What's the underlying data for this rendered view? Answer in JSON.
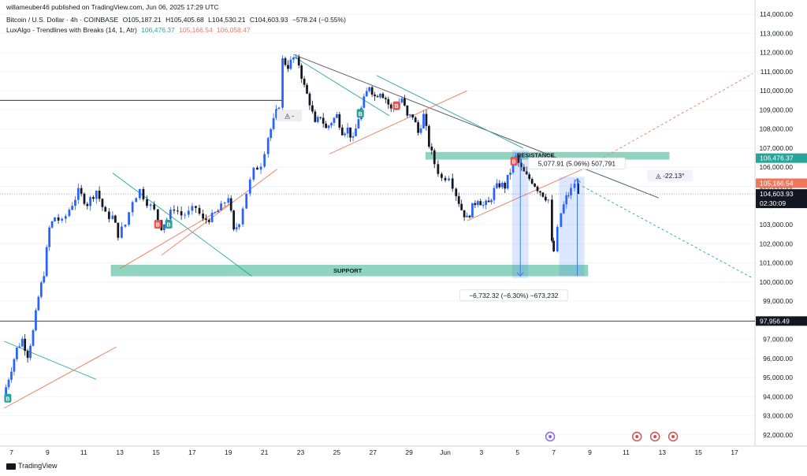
{
  "header": {
    "publisher": "willameuber46 published on TradingView.com, Jun 06, 2025 17:29 UTC",
    "symbol": "Bitcoin / U.S. Dollar · 4h · COINBASE",
    "ohlc": {
      "o": "O105,187.21",
      "h": "H105,405.68",
      "l": "L104,530.21",
      "c": "C104,603.93",
      "chg": "−578.24 (−0.55%)"
    },
    "indicator": {
      "name": "LuxAlgo - Trendlines with Breaks (14, 1, Atr)",
      "v1": "106,476.37",
      "v2": "105,166.54",
      "v3": "106,058.47"
    }
  },
  "footer": {
    "brand": "TradingView"
  },
  "colors": {
    "up": "#2962ff",
    "down": "#131722",
    "teal": "#26a69a",
    "zone": "#8fd4bf",
    "red_trend": "#f0785a",
    "measure": "#3f7af5"
  },
  "price_labels": {
    "upper": "106,476.37",
    "lower": "105,166.54",
    "last": "104,603.93",
    "countdown": "02:30:09",
    "hline": "97,956.49"
  },
  "annotations": {
    "resistance": "RESISTANCE",
    "support": "SUPPORT",
    "measure_up": "5,077.91 (5.06%) 507,791",
    "measure_down": "−6,732.32 (−6.30%) −673,232",
    "angle_right": "-22.13°",
    "angle_left": "-",
    "break_b": "B"
  },
  "chart_data": {
    "type": "candlestick",
    "title": "Bitcoin / U.S. Dollar · 4h · COINBASE",
    "ylim": [
      91500,
      114500
    ],
    "y_ticks": [
      "92,000.00",
      "93,000.00",
      "94,000.00",
      "95,000.00",
      "96,000.00",
      "97,000.00",
      "98,000.00",
      "99,000.00",
      "100,000.00",
      "101,000.00",
      "102,000.00",
      "103,000.00",
      "104,000.00",
      "105,000.00",
      "106,000.00",
      "107,000.00",
      "108,000.00",
      "109,000.00",
      "110,000.00",
      "111,000.00",
      "112,000.00",
      "113,000.00",
      "114,000.00"
    ],
    "x_ticks": [
      "7",
      "9",
      "11",
      "13",
      "15",
      "17",
      "19",
      "21",
      "23",
      "25",
      "27",
      "29",
      "Jun",
      "3",
      "5",
      "7",
      "9",
      "11",
      "13",
      "15",
      "17"
    ],
    "x_tick_days": [
      7,
      9,
      11,
      13,
      15,
      17,
      19,
      21,
      23,
      25,
      27,
      29,
      31,
      33,
      35,
      37,
      39,
      41,
      43,
      45,
      47
    ],
    "x_range_days": [
      6.5,
      48
    ],
    "last_candle_day": 37,
    "key_levels": {
      "resistance": [
        106400,
        106800
      ],
      "support": [
        100300,
        100900
      ],
      "hline_upper": 109500,
      "hline_lower": 97956.49,
      "last_price": 104603.93
    },
    "path": [
      [
        6.55,
        94000
      ],
      [
        7.0,
        95500
      ],
      [
        7.3,
        96500
      ],
      [
        7.6,
        97000
      ],
      [
        7.9,
        96200
      ],
      [
        8.2,
        97400
      ],
      [
        8.5,
        99200
      ],
      [
        8.8,
        100500
      ],
      [
        9.1,
        102800
      ],
      [
        9.4,
        103400
      ],
      [
        9.8,
        103100
      ],
      [
        10.2,
        103800
      ],
      [
        10.7,
        104700
      ],
      [
        11.2,
        104100
      ],
      [
        11.7,
        104800
      ],
      [
        12.2,
        103500
      ],
      [
        12.6,
        103400
      ],
      [
        12.9,
        102500
      ],
      [
        13.3,
        103000
      ],
      [
        13.7,
        104300
      ],
      [
        14.1,
        104800
      ],
      [
        14.5,
        104200
      ],
      [
        14.9,
        103700
      ],
      [
        15.3,
        102900
      ],
      [
        15.6,
        103300
      ],
      [
        16.0,
        103900
      ],
      [
        16.4,
        103500
      ],
      [
        16.8,
        103600
      ],
      [
        17.2,
        103900
      ],
      [
        17.6,
        103200
      ],
      [
        18.1,
        103400
      ],
      [
        18.6,
        103900
      ],
      [
        19.0,
        104500
      ],
      [
        19.3,
        102600
      ],
      [
        19.6,
        103200
      ],
      [
        20.0,
        104700
      ],
      [
        20.4,
        105800
      ],
      [
        20.8,
        106200
      ],
      [
        21.2,
        107600
      ],
      [
        21.5,
        108400
      ],
      [
        21.8,
        109300
      ],
      [
        22.0,
        111600
      ],
      [
        22.3,
        111300
      ],
      [
        22.6,
        111700
      ],
      [
        22.9,
        111400
      ],
      [
        23.2,
        110200
      ],
      [
        23.5,
        109400
      ],
      [
        23.8,
        108200
      ],
      [
        24.1,
        108700
      ],
      [
        24.4,
        108000
      ],
      [
        24.7,
        108400
      ],
      [
        25.0,
        108700
      ],
      [
        25.3,
        107900
      ],
      [
        25.6,
        108000
      ],
      [
        25.9,
        107400
      ],
      [
        26.2,
        108600
      ],
      [
        26.5,
        109500
      ],
      [
        26.8,
        110300
      ],
      [
        27.1,
        109700
      ],
      [
        27.4,
        110000
      ],
      [
        27.7,
        109600
      ],
      [
        28.0,
        109000
      ],
      [
        28.3,
        109200
      ],
      [
        28.6,
        109600
      ],
      [
        28.9,
        108600
      ],
      [
        29.2,
        108700
      ],
      [
        29.5,
        107800
      ],
      [
        29.8,
        108700
      ],
      [
        30.1,
        107200
      ],
      [
        30.4,
        106200
      ],
      [
        30.8,
        105400
      ],
      [
        31.2,
        105600
      ],
      [
        31.6,
        104600
      ],
      [
        31.9,
        103800
      ],
      [
        32.2,
        103300
      ],
      [
        32.5,
        103900
      ],
      [
        32.8,
        104400
      ],
      [
        33.1,
        104000
      ],
      [
        33.4,
        104100
      ],
      [
        33.7,
        104800
      ],
      [
        34.0,
        105100
      ],
      [
        34.3,
        105000
      ],
      [
        34.6,
        105800
      ],
      [
        34.9,
        106500
      ],
      [
        35.2,
        105900
      ],
      [
        35.5,
        105500
      ],
      [
        35.8,
        105300
      ],
      [
        36.1,
        104900
      ],
      [
        36.4,
        104600
      ],
      [
        36.7,
        104300
      ],
      [
        36.9,
        102000
      ],
      [
        37.0,
        101600
      ],
      [
        37.2,
        102700
      ],
      [
        37.4,
        103600
      ],
      [
        37.7,
        104400
      ],
      [
        37.95,
        104800
      ],
      [
        38.15,
        105200
      ],
      [
        38.35,
        104603
      ]
    ]
  }
}
